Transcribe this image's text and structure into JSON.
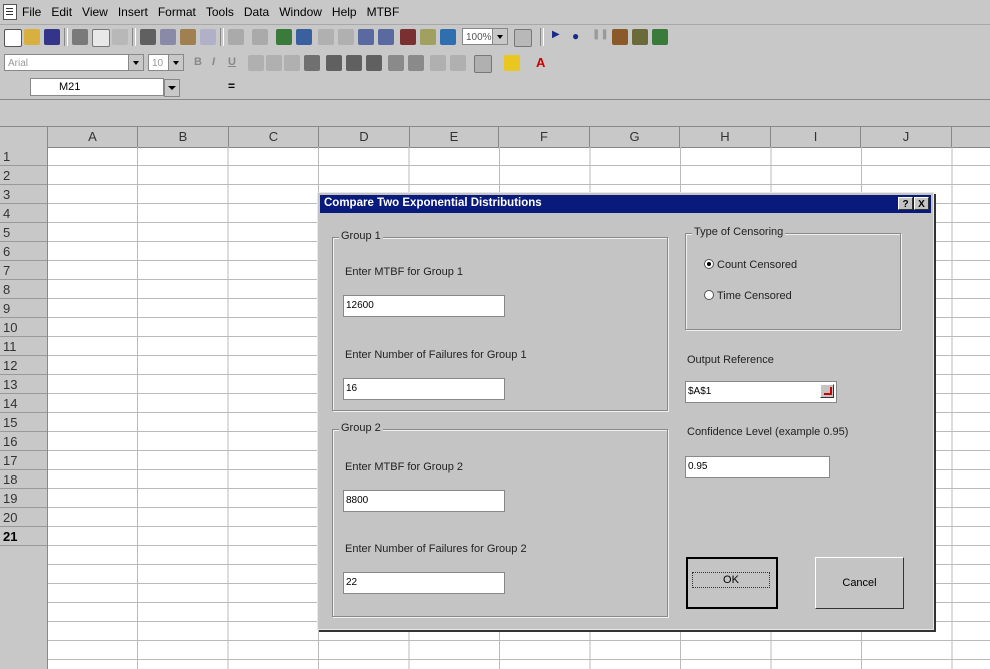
{
  "menu": [
    "File",
    "Edit",
    "View",
    "Insert",
    "Format",
    "Tools",
    "Data",
    "Window",
    "Help",
    "MTBF"
  ],
  "toolbar": {
    "zoom": "100%",
    "font_name": "Arial",
    "font_size": "10"
  },
  "formula_bar": {
    "name_box": "M21",
    "equals": "="
  },
  "columns": [
    "A",
    "B",
    "C",
    "D",
    "E",
    "F",
    "G",
    "H",
    "I",
    "J"
  ],
  "rows": [
    "1",
    "2",
    "3",
    "4",
    "5",
    "6",
    "7",
    "8",
    "9",
    "10",
    "11",
    "12",
    "13",
    "14",
    "15",
    "16",
    "17",
    "18",
    "19",
    "20",
    "21"
  ],
  "dialog": {
    "title": "Compare Two Exponential Distributions",
    "help_btn": "?",
    "close_btn": "X",
    "group1": {
      "label": "Group 1",
      "mtbf_label": "Enter MTBF for Group 1",
      "mtbf_value": "12600",
      "failures_label": "Enter Number of Failures for Group 1",
      "failures_value": "16"
    },
    "group2": {
      "label": "Group 2",
      "mtbf_label": "Enter MTBF for Group 2",
      "mtbf_value": "8800",
      "failures_label": "Enter Number of Failures for Group 2",
      "failures_value": "22"
    },
    "censoring": {
      "label": "Type of Censoring",
      "options": [
        "Count Censored",
        "Time Censored"
      ],
      "selected": "Count Censored"
    },
    "output_reference": {
      "label": "Output Reference",
      "value": "$A$1"
    },
    "confidence": {
      "label": "Confidence Level (example 0.95)",
      "value": "0.95"
    },
    "ok_label": "OK",
    "cancel_label": "Cancel"
  }
}
